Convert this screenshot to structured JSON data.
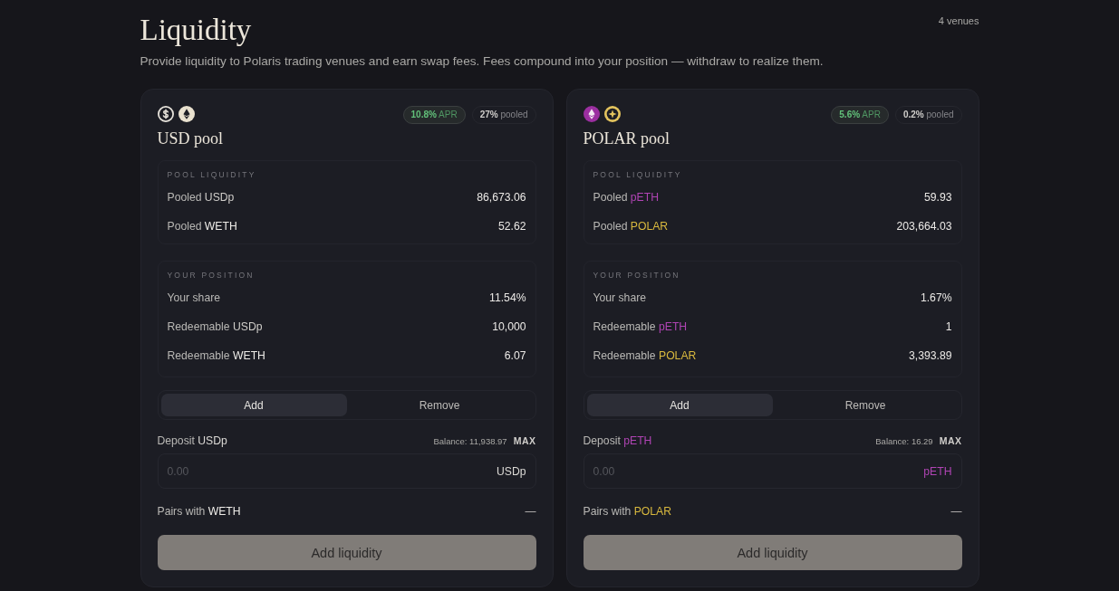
{
  "header": {
    "title": "Liquidity",
    "subtitle": "Provide liquidity to Polaris trading venues and earn swap fees. Fees compound into your position — withdraw to realize them.",
    "venue_count": "4 venues"
  },
  "pools": [
    {
      "title": "USD pool",
      "token_icons": [
        {
          "kind": "dollar",
          "color": "#e6e2da"
        },
        {
          "kind": "diamond",
          "color": "#e9e1cf"
        }
      ],
      "apr": {
        "value": "10.8%",
        "label": "APR"
      },
      "pooled": {
        "value": "27%",
        "label": "pooled"
      },
      "sections": [
        {
          "heading": "POOL LIQUIDITY",
          "rows": [
            {
              "label": "Pooled",
              "token": {
                "text": "USDp",
                "color": "#cfcdc9"
              },
              "value": "86,673.06"
            },
            {
              "label": "Pooled",
              "token": {
                "text": "WETH",
                "color": "#eeece8"
              },
              "value": "52.62"
            }
          ]
        },
        {
          "heading": "YOUR POSITION",
          "rows": [
            {
              "label": "Your share",
              "value": "11.54%"
            },
            {
              "label": "Redeemable",
              "token": {
                "text": "USDp",
                "color": "#cfcdc9"
              },
              "value": "10,000"
            },
            {
              "label": "Redeemable",
              "token": {
                "text": "WETH",
                "color": "#eeece8"
              },
              "value": "6.07"
            }
          ]
        }
      ],
      "tabs": [
        {
          "label": "Add",
          "selected": true
        },
        {
          "label": "Remove",
          "selected": false
        }
      ],
      "deposit": {
        "label": "Deposit",
        "token": {
          "text": "USDp",
          "color": "#dcdad6"
        },
        "balance": "Balance: 11,938.97",
        "max": "MAX",
        "placeholder": "0.00",
        "unit": "USDp"
      },
      "pairs": {
        "label": "Pairs with",
        "token": {
          "text": "WETH",
          "color": "#eeece8"
        },
        "value": "—"
      },
      "submit": {
        "label": "Add liquidity",
        "disabled": true
      }
    },
    {
      "title": "POLAR pool",
      "token_icons": [
        {
          "kind": "diamond",
          "color": "#9b2fa0"
        },
        {
          "kind": "star",
          "color": "#e3c35e"
        }
      ],
      "apr": {
        "value": "5.6%",
        "label": "APR"
      },
      "pooled": {
        "value": "0.2%",
        "label": "pooled"
      },
      "sections": [
        {
          "heading": "POOL LIQUIDITY",
          "rows": [
            {
              "label": "Pooled",
              "token": {
                "text": "pETH",
                "color": "#b044b4"
              },
              "value": "59.93"
            },
            {
              "label": "Pooled",
              "token": {
                "text": "POLAR",
                "color": "#d9b93e"
              },
              "value": "203,664.03"
            }
          ]
        },
        {
          "heading": "YOUR POSITION",
          "rows": [
            {
              "label": "Your share",
              "value": "1.67%"
            },
            {
              "label": "Redeemable",
              "token": {
                "text": "pETH",
                "color": "#b044b4"
              },
              "value": "1"
            },
            {
              "label": "Redeemable",
              "token": {
                "text": "POLAR",
                "color": "#d9b93e"
              },
              "value": "3,393.89"
            }
          ]
        }
      ],
      "tabs": [
        {
          "label": "Add",
          "selected": true
        },
        {
          "label": "Remove",
          "selected": false
        }
      ],
      "deposit": {
        "label": "Deposit",
        "token": {
          "text": "pETH",
          "color": "#b044b4"
        },
        "balance": "Balance: 16.29",
        "max": "MAX",
        "placeholder": "0.00",
        "unit": "pETH"
      },
      "pairs": {
        "label": "Pairs with",
        "token": {
          "text": "POLAR",
          "color": "#d9b93e"
        },
        "value": "—"
      },
      "submit": {
        "label": "Add liquidity",
        "disabled": true
      }
    }
  ]
}
